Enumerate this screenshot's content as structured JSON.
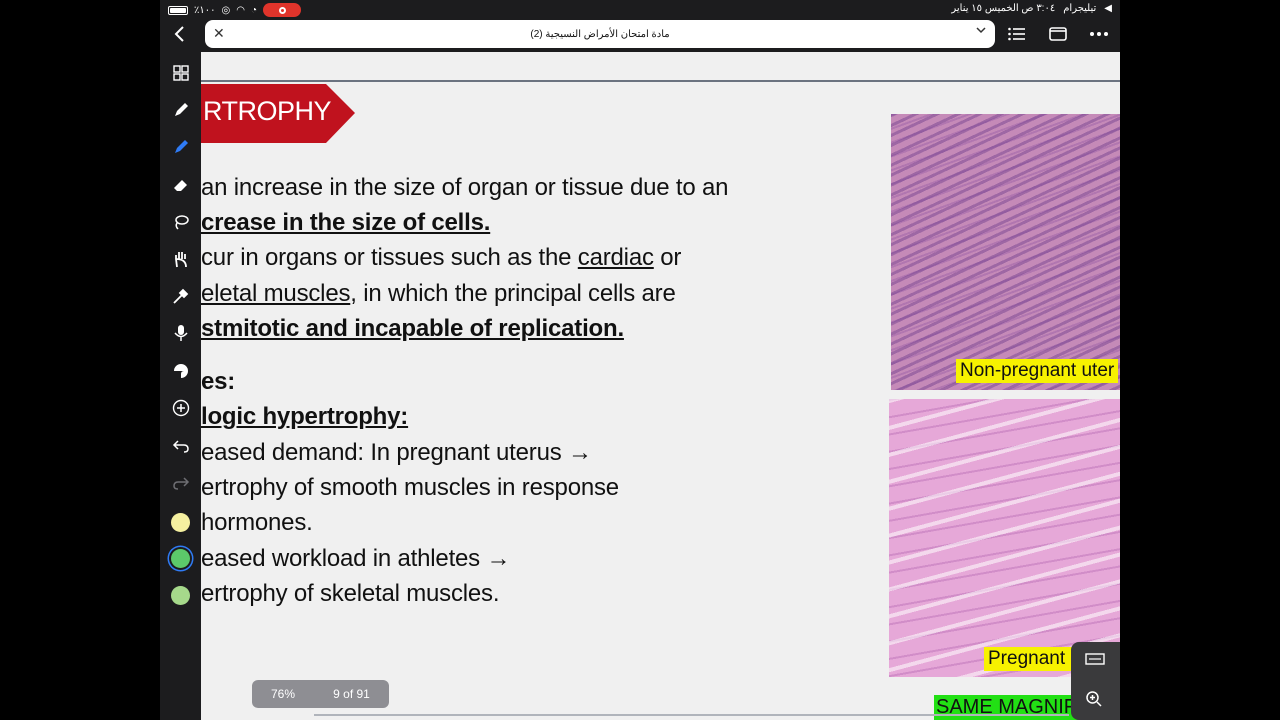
{
  "status_bar": {
    "battery": "٪١٠٠",
    "right_text": "تيليجرام",
    "datetime": "٣:٠٤ ص  الخميس ١٥ يناير"
  },
  "toolbar": {
    "title": "مادة امتحان الأمراض النسيجية (2)"
  },
  "left_toolbar": {
    "swatch_colors": [
      "#f5f0a0",
      "#5cc96a",
      "#a6d98b"
    ]
  },
  "slide": {
    "heading": "RTROPHY",
    "heading_color": "#c0121e",
    "lines": {
      "l1": "an increase in the size of organ or tissue due to an",
      "l2": "crease in the size of cells.",
      "l3a": "cur in organs or tissues such as  the ",
      "l3b": "cardiac",
      "l3c": " or",
      "l4a": "eletal muscles",
      "l4b": ", in which the principal  cells are",
      "l5": "stmitotic and incapable of replication.",
      "l6": "es:",
      "l7": "logic hypertrophy:",
      "l8": "eased demand: In pregnant uterus →",
      "l9": "ertrophy of smooth muscles in response",
      "l10": "hormones.",
      "l11": "eased workload in athletes →",
      "l12": "ertrophy of skeletal muscles."
    },
    "image_top_label": "Non-pregnant uter",
    "image_bottom_label": "Pregnant uter",
    "same_magnification": "SAME MAGNIFICAT"
  },
  "page_indicator": {
    "zoom": "76%",
    "page": "9 of 91"
  }
}
